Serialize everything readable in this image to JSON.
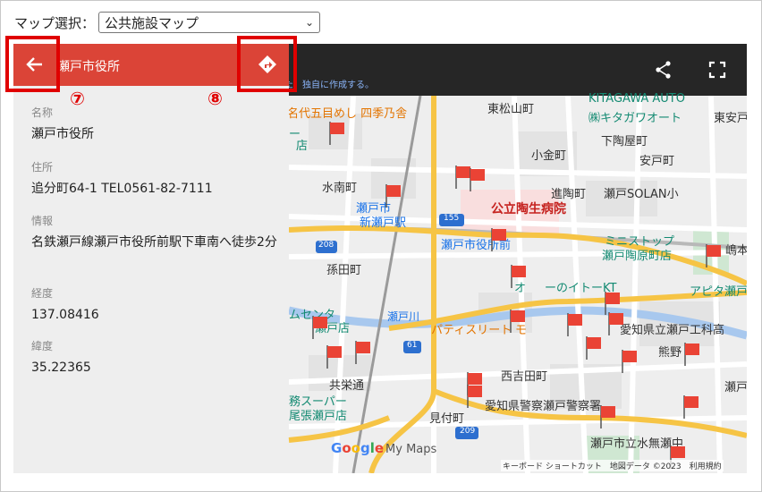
{
  "selector": {
    "label": "マップ選択：",
    "value": "公共施設マップ"
  },
  "panel": {
    "title": "瀬戸市役所",
    "fields": [
      {
        "key": "名称",
        "value": "瀬戸市役所"
      },
      {
        "key": "住所",
        "value": "追分町64-1 TEL0561-82-7111"
      },
      {
        "key": "情報",
        "value": "名鉄瀬戸線瀬戸市役所前駅下車南へ徒歩2分"
      },
      {
        "key": "経度",
        "value": "137.08416"
      },
      {
        "key": "緯度",
        "value": "35.22365"
      }
    ]
  },
  "toolbar": {
    "hint": "た、独自に作成する。",
    "icons": [
      "share-icon",
      "fullscreen-icon"
    ]
  },
  "map": {
    "labels": {
      "restaurant": "名代五目めし 四季乃舎",
      "store1": "ー",
      "store2": "店",
      "higashimatsuyama": "東松山町",
      "kitagawa_en": "KITAGAWA AUTO",
      "kitagawa_jp": "㈱キタガワオート",
      "higashiyado": "東安戸町",
      "shimoyaya": "下陶屋町",
      "kogane": "小金町",
      "yasudo": "安戸町",
      "minaminami": "水南町",
      "shintocho": "進陶町",
      "setoshi_station": "瀬戸市",
      "shinsetoeki": "新瀬戸駅",
      "hospital": "公立陶生病院",
      "solan": "瀬戸SOLAN小",
      "city_hall_station": "瀬戸市役所前",
      "ministop1": "ミニストップ",
      "ministop2": "瀬戸陶原町店",
      "shima": "嶋本町",
      "magotacho": "孫田町",
      "ohi": "オ",
      "ito": "ーのイトーKT",
      "apita": "アピタ瀬戸",
      "center": "ムセンタ",
      "center2": "瀬戸店",
      "setogawa": "瀬戸川",
      "patisserie": "パティスリート",
      "ae": "モ",
      "aichi_kogyo": "愛知県立瀬戸工科高",
      "kumano": "熊野",
      "nishikoda": "西吉田町",
      "kyoei": "共栄通",
      "police": "愛知県警察瀬戸警察署",
      "mitsuke": "見付町",
      "seto": "瀬戸",
      "supermarket1": "務スーパー",
      "supermarket2": "尾張瀬戸店",
      "school": "瀬戸市立水無瀬中",
      "route155": "155",
      "route208": "208",
      "route61": "61",
      "route209": "209"
    },
    "attribution": "キーボード ショートカット　地図データ ©2023　利用規約",
    "logo": {
      "g": "G",
      "o1": "o",
      "o2": "o",
      "g2": "g",
      "l": "l",
      "e": "e",
      "maps": "My Maps"
    }
  },
  "annotations": {
    "n7": "⑦",
    "n8": "⑧"
  },
  "colors": {
    "header_red": "#db4437",
    "toolbar": "#262626",
    "highlight": "#e00000",
    "flag": "#ea4335"
  }
}
